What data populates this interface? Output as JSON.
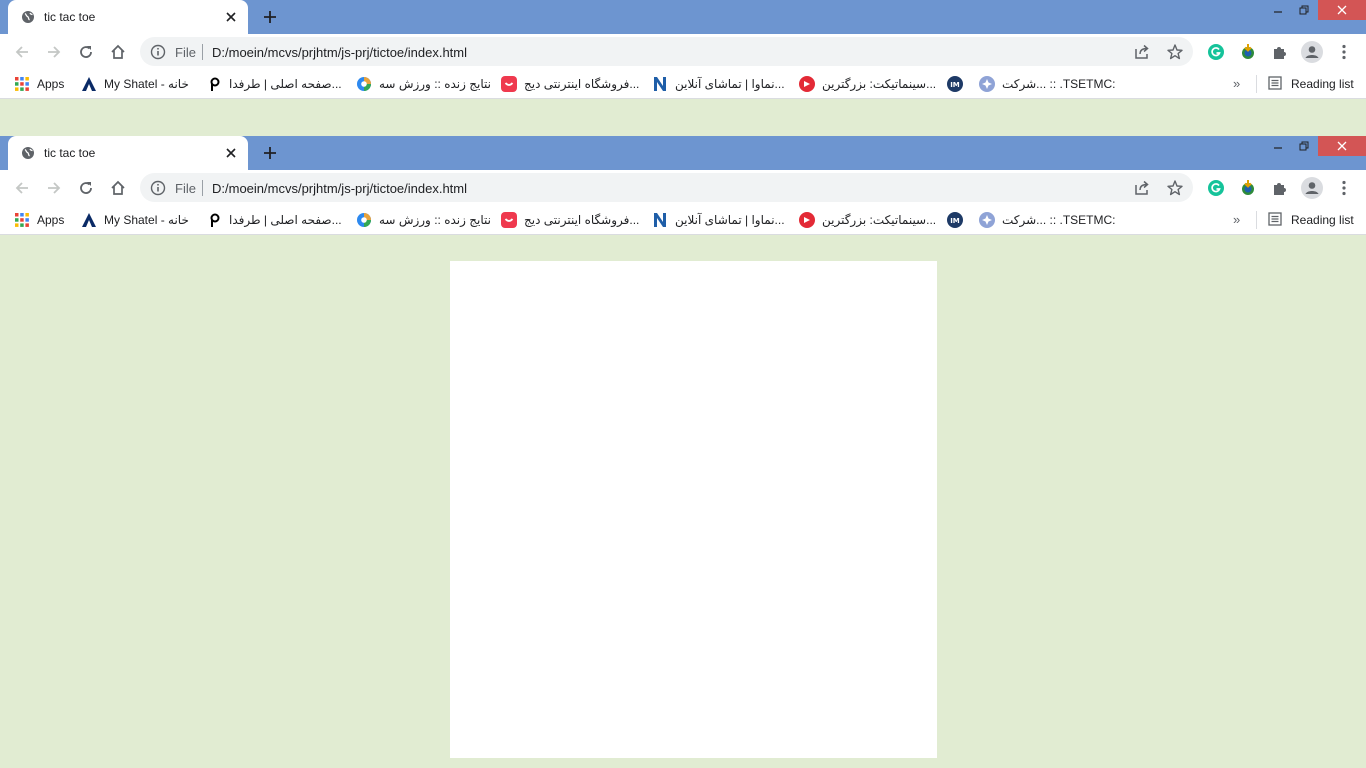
{
  "tab": {
    "title": "tic tac toe",
    "favicon": "globe-icon"
  },
  "window": {
    "minimize": "minimize-icon",
    "restore": "restore-icon",
    "close": "close-icon",
    "close_color": "#d35555",
    "titlebar_color": "#6d95d0"
  },
  "omnibox": {
    "scheme": "File",
    "url": "D:/moein/mcvs/prjhtm/js-prj/tictoe/index.html"
  },
  "bookmarks": {
    "items": [
      {
        "label": "Apps",
        "icon": "apps-grid-icon"
      },
      {
        "label": "My Shatel - خانه",
        "icon": "shatel-icon"
      },
      {
        "label": "صفحه اصلی | طرفدا...",
        "icon": "tarafdari-icon"
      },
      {
        "label": "نتایج زنده :: ورزش سه",
        "icon": "varzesh3-icon"
      },
      {
        "label": "فروشگاه اینترنتی دیج...",
        "icon": "digikala-icon"
      },
      {
        "label": "نماوا | تماشای آنلاین...",
        "icon": "namava-icon"
      },
      {
        "label": "سینماتیکت: بزرگترین...",
        "icon": "cinematicket-icon"
      },
      {
        "label": "",
        "icon": "im-icon"
      },
      {
        "label": "شرکت... :: .TSETMC:",
        "icon": "tsetmc-icon"
      }
    ],
    "reading_list": "Reading list"
  },
  "page": {
    "background": "#e1ecd2",
    "board_background": "#ffffff"
  }
}
